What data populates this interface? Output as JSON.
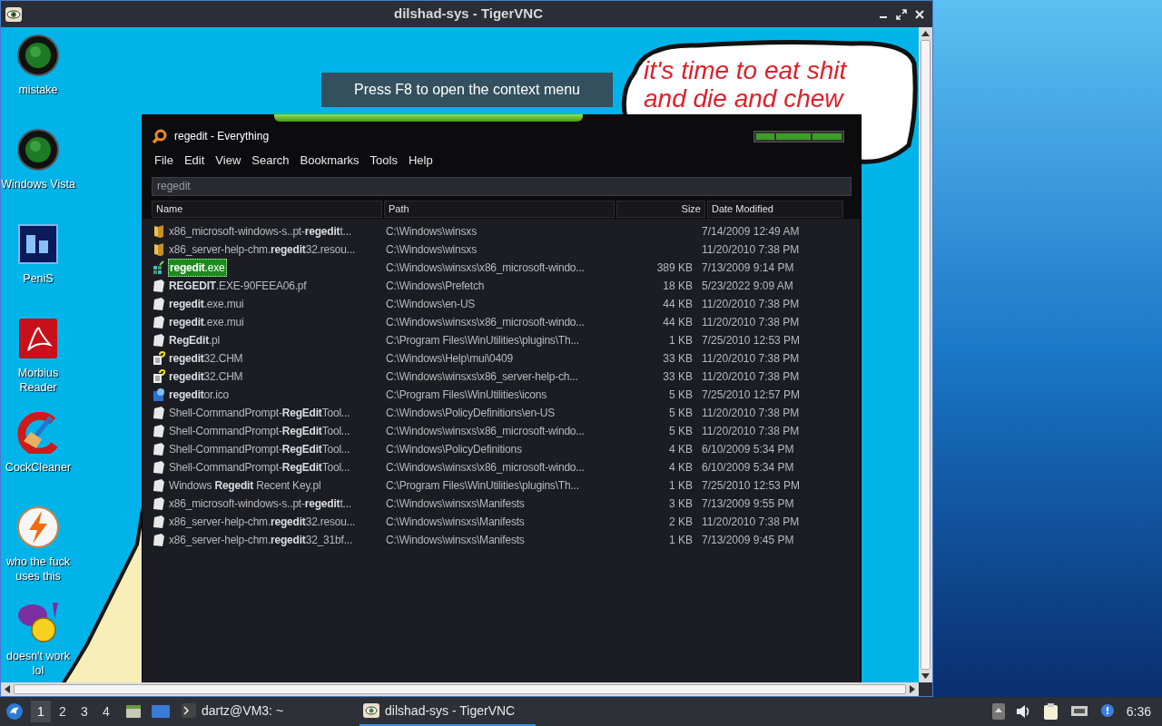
{
  "vnc_window": {
    "title": "dilshad-sys - TigerVNC"
  },
  "remote_desktop": {
    "icons": [
      {
        "label": "mistake",
        "kind": "orb"
      },
      {
        "label": "Windows Vista",
        "kind": "orb"
      },
      {
        "label": "PeniS",
        "kind": "ps"
      },
      {
        "label": "Morbius Reader",
        "kind": "pdf"
      },
      {
        "label": "CockCleaner",
        "kind": "cleaner"
      },
      {
        "label": "who the fuck uses this",
        "kind": "bolt"
      },
      {
        "label": "doesn't work lol",
        "kind": "messenger"
      }
    ],
    "toast": "Press F8 to open the context menu",
    "bubble": [
      "it's time to eat shit",
      "and die and chew"
    ]
  },
  "everything": {
    "title": "regedit - Everything",
    "menu": [
      "File",
      "Edit",
      "View",
      "Search",
      "Bookmarks",
      "Tools",
      "Help"
    ],
    "search": {
      "value": "regedit"
    },
    "columns": [
      "Name",
      "Path",
      "Size",
      "Date Modified"
    ],
    "rows": [
      {
        "kind": "folder",
        "name": "x86_microsoft-windows-s..pt-**regedit**t...",
        "path": "C:\\Windows\\winsxs",
        "date": "7/14/2009 12:49 AM",
        "selected": false
      },
      {
        "kind": "folder",
        "name": "x86_server-help-chm.**regedit**32.resou...",
        "path": "C:\\Windows\\winsxs",
        "date": "11/20/2010 7:38 PM",
        "selected": false
      },
      {
        "kind": "exe",
        "name": "**regedit**.exe",
        "path": "C:\\Windows\\winsxs\\x86_microsoft-windo...",
        "size": "389 KB",
        "date": "7/13/2009 9:14 PM",
        "selected": true
      },
      {
        "kind": "file",
        "name": "**REGEDIT**.EXE-90FEEA06.pf",
        "path": "C:\\Windows\\Prefetch",
        "size": "18 KB",
        "date": "5/23/2022 9:09 AM",
        "selected": false
      },
      {
        "kind": "file",
        "name": "**regedit**.exe.mui",
        "path": "C:\\Windows\\en-US",
        "size": "44 KB",
        "date": "11/20/2010 7:38 PM",
        "selected": false
      },
      {
        "kind": "file",
        "name": "**regedit**.exe.mui",
        "path": "C:\\Windows\\winsxs\\x86_microsoft-windo...",
        "size": "44 KB",
        "date": "11/20/2010 7:38 PM",
        "selected": false
      },
      {
        "kind": "file",
        "name": "**RegEdit**.pl",
        "path": "C:\\Program Files\\WinUtilities\\plugins\\Th...",
        "size": "1 KB",
        "date": "7/25/2010 12:53 PM",
        "selected": false
      },
      {
        "kind": "help",
        "name": "**regedit**32.CHM",
        "path": "C:\\Windows\\Help\\mui\\0409",
        "size": "33 KB",
        "date": "11/20/2010 7:38 PM",
        "selected": false
      },
      {
        "kind": "help",
        "name": "**regedit**32.CHM",
        "path": "C:\\Windows\\winsxs\\x86_server-help-ch...",
        "size": "33 KB",
        "date": "11/20/2010 7:38 PM",
        "selected": false
      },
      {
        "kind": "ico",
        "name": "**regedit**or.ico",
        "path": "C:\\Program Files\\WinUtilities\\icons",
        "size": "5 KB",
        "date": "7/25/2010 12:57 PM",
        "selected": false
      },
      {
        "kind": "file",
        "name": "Shell-CommandPrompt-**RegEdit**Tool...",
        "path": "C:\\Windows\\PolicyDefinitions\\en-US",
        "size": "5 KB",
        "date": "11/20/2010 7:38 PM",
        "selected": false
      },
      {
        "kind": "file",
        "name": "Shell-CommandPrompt-**RegEdit**Tool...",
        "path": "C:\\Windows\\winsxs\\x86_microsoft-windo...",
        "size": "5 KB",
        "date": "11/20/2010 7:38 PM",
        "selected": false
      },
      {
        "kind": "file",
        "name": "Shell-CommandPrompt-**RegEdit**Tool...",
        "path": "C:\\Windows\\PolicyDefinitions",
        "size": "4 KB",
        "date": "6/10/2009 5:34 PM",
        "selected": false
      },
      {
        "kind": "file",
        "name": "Shell-CommandPrompt-**RegEdit**Tool...",
        "path": "C:\\Windows\\winsxs\\x86_microsoft-windo...",
        "size": "4 KB",
        "date": "6/10/2009 5:34 PM",
        "selected": false
      },
      {
        "kind": "file",
        "name": "Windows **Regedit** Recent Key.pl",
        "path": "C:\\Program Files\\WinUtilities\\plugins\\Th...",
        "size": "1 KB",
        "date": "7/25/2010 12:53 PM",
        "selected": false
      },
      {
        "kind": "file",
        "name": "x86_microsoft-windows-s..pt-**regedit**t...",
        "path": "C:\\Windows\\winsxs\\Manifests",
        "size": "3 KB",
        "date": "7/13/2009 9:55 PM",
        "selected": false
      },
      {
        "kind": "file",
        "name": "x86_server-help-chm.**regedit**32.resou...",
        "path": "C:\\Windows\\winsxs\\Manifests",
        "size": "2 KB",
        "date": "11/20/2010 7:38 PM",
        "selected": false
      },
      {
        "kind": "file",
        "name": "x86_server-help-chm.**regedit**32_31bf...",
        "path": "C:\\Windows\\winsxs\\Manifests",
        "size": "1 KB",
        "date": "7/13/2009 9:45 PM",
        "selected": false
      }
    ]
  },
  "taskbar": {
    "workspaces": [
      {
        "label": "1",
        "selected": true
      },
      {
        "label": "2",
        "selected": false
      },
      {
        "label": "3",
        "selected": false
      },
      {
        "label": "4",
        "selected": false
      }
    ],
    "tasks": [
      {
        "label": "dartz@VM3: ~",
        "kind": "terminal",
        "selected": false
      },
      {
        "label": "dilshad-sys - TigerVNC",
        "kind": "vnc",
        "selected": true
      }
    ],
    "clock": "6:36"
  }
}
